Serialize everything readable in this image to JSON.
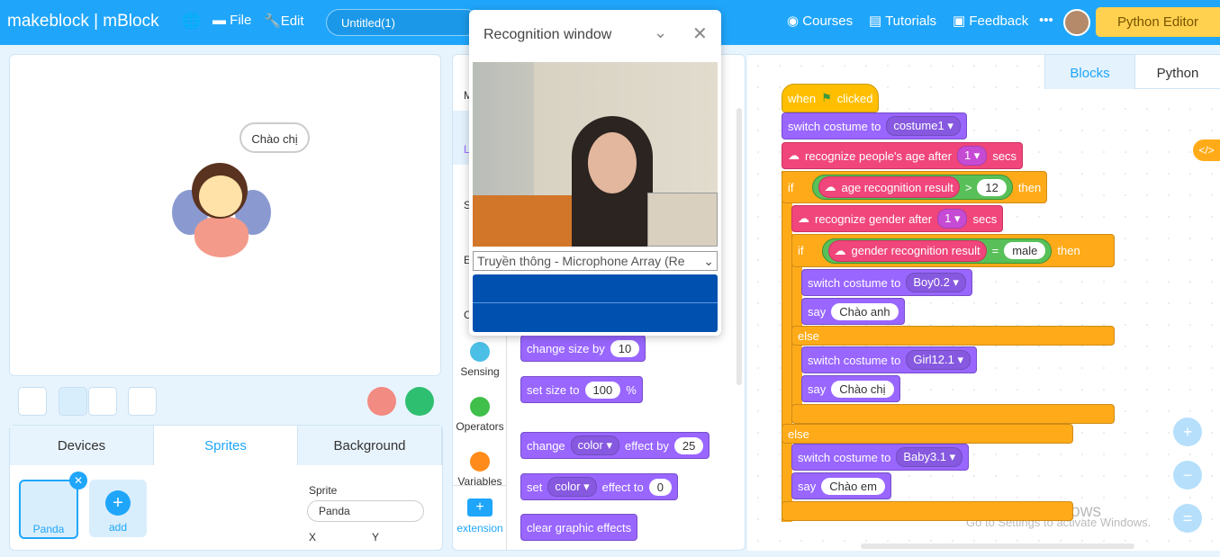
{
  "topbar": {
    "logo": "makeblock | mBlock",
    "file": "File",
    "edit": "Edit",
    "project_title": "Untitled(1)",
    "courses": "Courses",
    "tutorials": "Tutorials",
    "feedback": "Feedback",
    "more": "•••",
    "python_editor": "Python Editor"
  },
  "stage": {
    "speech": "Chào chị"
  },
  "tabs": {
    "devices": "Devices",
    "sprites": "Sprites",
    "background": "Background"
  },
  "sprites": {
    "items": [
      {
        "name": "Panda"
      }
    ],
    "add": "add",
    "sprite_label": "Sprite",
    "sprite_name": "Panda",
    "x_label": "X",
    "y_label": "Y"
  },
  "categories": [
    {
      "label": "M"
    },
    {
      "label": "L"
    },
    {
      "label": "S"
    },
    {
      "label": "E"
    },
    {
      "label": "C"
    },
    {
      "label": "Sensing",
      "color": "#4cbfe6"
    },
    {
      "label": "Operators",
      "color": "#40bf4a"
    },
    {
      "label": "Variables",
      "color": "#ff8c1a"
    }
  ],
  "extension": "extension",
  "palette": {
    "change_size": {
      "text": "change size by",
      "value": "10"
    },
    "set_size": {
      "text": "set size to",
      "value": "100",
      "unit": "%"
    },
    "change_effect": {
      "text": "change",
      "effect": "color",
      "text2": "effect by",
      "value": "25"
    },
    "set_effect": {
      "text": "set",
      "effect": "color",
      "text2": "effect to",
      "value": "0"
    },
    "clear": "clear graphic effects"
  },
  "recognition": {
    "title": "Recognition window",
    "mic_select": "Truyền thông - Microphone Array (Re"
  },
  "code_tabs": {
    "blocks": "Blocks",
    "python": "Python"
  },
  "script": {
    "when": "when",
    "clicked": "clicked",
    "switch": "switch costume to",
    "costume1": "costume1",
    "age": "recognize people's age after",
    "age_val": "1",
    "secs": "secs",
    "if": "if",
    "age_result": "age recognition result",
    "gt": ">",
    "age_cmp": "12",
    "then": "then",
    "gender": "recognize gender after",
    "gender_val": "1",
    "gender_result": "gender recognition result",
    "eq": "=",
    "male": "male",
    "boy": "Boy0.2",
    "say": "say",
    "say1": "Chào anh",
    "else": "else",
    "girl": "Girl12.1",
    "say2": "Chào chị",
    "baby": "Baby3.1",
    "say3": "Chào em"
  },
  "watermark": {
    "line1": "Activate Windows",
    "line2": "Go to Settings to activate Windows."
  },
  "colors": {
    "accent": "#1fa6fb",
    "looks": "#9966ff",
    "ai": "#f0467c",
    "control": "#ffab19",
    "operators": "#59c059"
  }
}
